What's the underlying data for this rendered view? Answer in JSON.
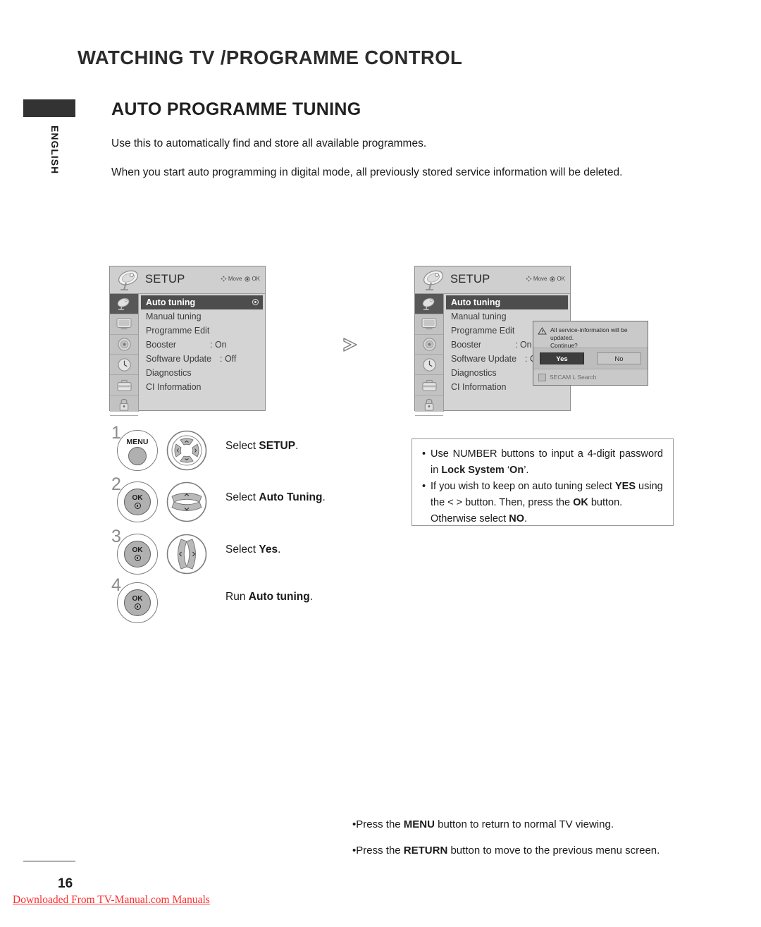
{
  "header": {
    "chapter_title": "WATCHING TV /PROGRAMME CONTROL",
    "section_title": "AUTO PROGRAMME TUNING",
    "language_tab": "ENGLISH",
    "intro_1": "Use this to automatically find and store all available programmes.",
    "intro_2": "When you start auto programming in digital mode, all previously stored service information will be deleted."
  },
  "osd": {
    "title": "SETUP",
    "hint_move": "Move",
    "hint_ok": "OK",
    "rail_icons": [
      "satellite-dish-icon",
      "tv-screen-icon",
      "audio-speaker-icon",
      "clock-icon",
      "toolbox-icon",
      "lock-icon"
    ],
    "items": [
      {
        "label": "Auto tuning",
        "value": "",
        "selected": true,
        "radio": true
      },
      {
        "label": "Manual tuning",
        "value": "",
        "selected": false,
        "radio": false
      },
      {
        "label": "Programme Edit",
        "value": "",
        "selected": false,
        "radio": false
      },
      {
        "label": "Booster",
        "value": ": On",
        "selected": false,
        "radio": false
      },
      {
        "label": "Software Update",
        "value": ": Off",
        "selected": false,
        "radio": false
      },
      {
        "label": "Diagnostics",
        "value": "",
        "selected": false,
        "radio": false
      },
      {
        "label": "CI Information",
        "value": "",
        "selected": false,
        "radio": false
      }
    ]
  },
  "dialog": {
    "message_line_1": "All service-information will be updated.",
    "message_line_2": "Continue?",
    "yes_label": "Yes",
    "no_label": "No",
    "checkbox_label": "SECAM L Search",
    "checkbox_checked": false
  },
  "steps": [
    {
      "number": "1",
      "button": "MENU",
      "button_kind": "menu",
      "pad": "four-way",
      "text_prefix": "Select ",
      "text_bold": "SETUP",
      "text_suffix": "."
    },
    {
      "number": "2",
      "button": "OK",
      "button_kind": "ok",
      "pad": "up-down",
      "text_prefix": "Select ",
      "text_bold": "Auto Tuning",
      "text_suffix": "."
    },
    {
      "number": "3",
      "button": "OK",
      "button_kind": "ok",
      "pad": "left-right",
      "text_prefix": "Select ",
      "text_bold": "Yes",
      "text_suffix": "."
    },
    {
      "number": "4",
      "button": "OK",
      "button_kind": "ok",
      "pad": "none",
      "text_prefix": "Run ",
      "text_bold": "Auto tuning",
      "text_suffix": "."
    }
  ],
  "note_box": {
    "item_1": {
      "a": "Use NUMBER buttons to input a 4-digit password in ",
      "b": "Lock System",
      "c": " ‘",
      "d": "On",
      "e": "’."
    },
    "item_2": {
      "a": "If you wish to keep on auto tuning select ",
      "b": "YES",
      "c": " using the  <  >  button. Then, press the ",
      "d": "OK",
      "e": " button. Otherwise select ",
      "f": "NO",
      "g": "."
    }
  },
  "bottom_notes": {
    "note_1": {
      "a": "Press the ",
      "b": "MENU",
      "c": " button to return to normal TV viewing."
    },
    "note_2": {
      "a": "Press the ",
      "b": "RETURN",
      "c": " button to move to the previous menu screen."
    }
  },
  "footer": {
    "page_number": "16",
    "download_text": "Downloaded From TV-Manual.com Manuals"
  },
  "colors": {
    "accent_red": "#ff2d2d",
    "osd_panel": "#d4d4d4",
    "osd_selected": "#4d4d4d",
    "tab_black": "#333333"
  }
}
